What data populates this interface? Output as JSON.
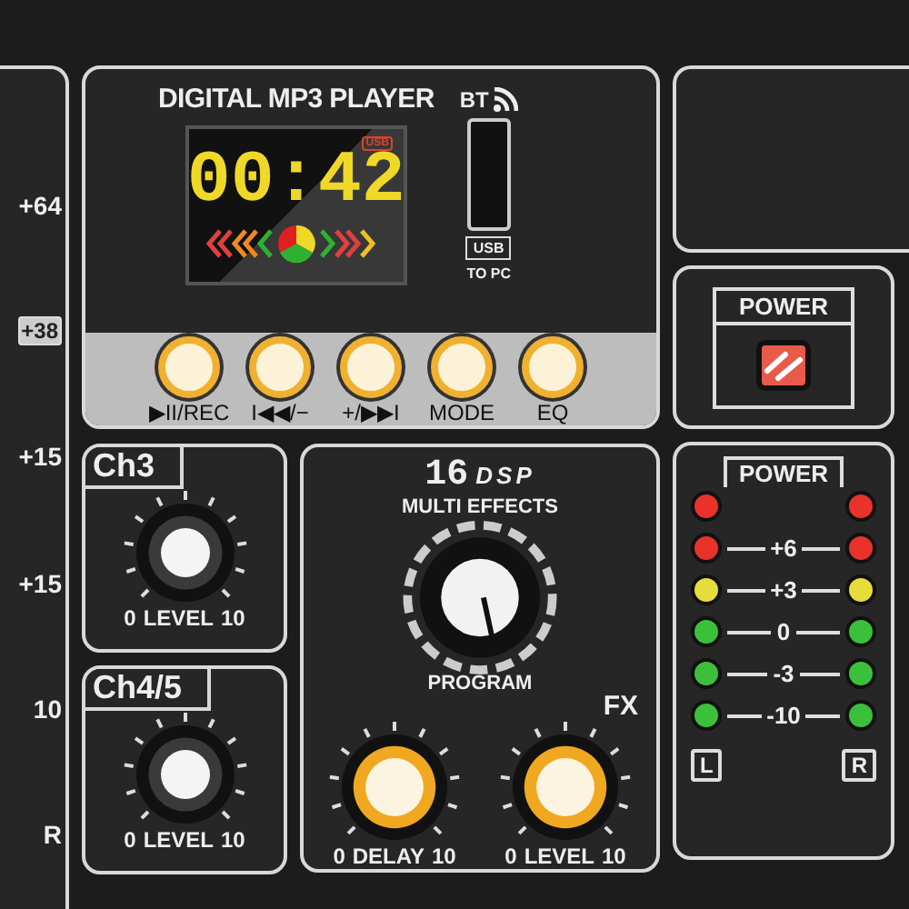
{
  "left_strip": {
    "labels": [
      {
        "text": "+64",
        "boxed": false
      },
      {
        "text": "+38",
        "boxed": true
      },
      {
        "text": "+15",
        "boxed": false
      },
      {
        "text": "+15",
        "boxed": false
      },
      {
        "text": "10",
        "boxed": false
      },
      {
        "text": "R",
        "boxed": false
      }
    ]
  },
  "mp3_player": {
    "title": "DIGITAL MP3 PLAYER",
    "bt_label": "BT",
    "display": {
      "badge": "USB",
      "time": "00:42"
    },
    "usb": {
      "label": "USB",
      "caption": "TO PC"
    },
    "buttons": [
      {
        "label": "▶II/REC"
      },
      {
        "label": "I◀◀/−"
      },
      {
        "label": "+/▶▶I"
      },
      {
        "label": "MODE"
      },
      {
        "label": "EQ"
      }
    ]
  },
  "power_switch": {
    "label": "POWER",
    "on": true
  },
  "channels": [
    {
      "name": "Ch3",
      "knob_label": "LEVEL",
      "min": "0",
      "max": "10"
    },
    {
      "name": "Ch4/5",
      "knob_label": "LEVEL",
      "min": "0",
      "max": "10"
    }
  ],
  "effects": {
    "count": "16",
    "dsp": "DSP",
    "title": "MULTI EFFECTS",
    "program_label": "PROGRAM",
    "fx_label": "FX",
    "knobs": [
      {
        "label": "DELAY",
        "min": "0",
        "max": "10"
      },
      {
        "label": "LEVEL",
        "min": "0",
        "max": "10"
      }
    ]
  },
  "meter": {
    "title": "POWER",
    "rows": [
      {
        "kind": "indicator",
        "color": "#e8322a"
      },
      {
        "kind": "scale",
        "label": "+6",
        "color": "#e8322a"
      },
      {
        "kind": "scale",
        "label": "+3",
        "color": "#e6dc3c"
      },
      {
        "kind": "scale",
        "label": "0",
        "color": "#3cc03c"
      },
      {
        "kind": "scale",
        "label": "-3",
        "color": "#3cc03c"
      },
      {
        "kind": "scale",
        "label": "-10",
        "color": "#3cc03c"
      }
    ],
    "left_label": "L",
    "right_label": "R"
  }
}
